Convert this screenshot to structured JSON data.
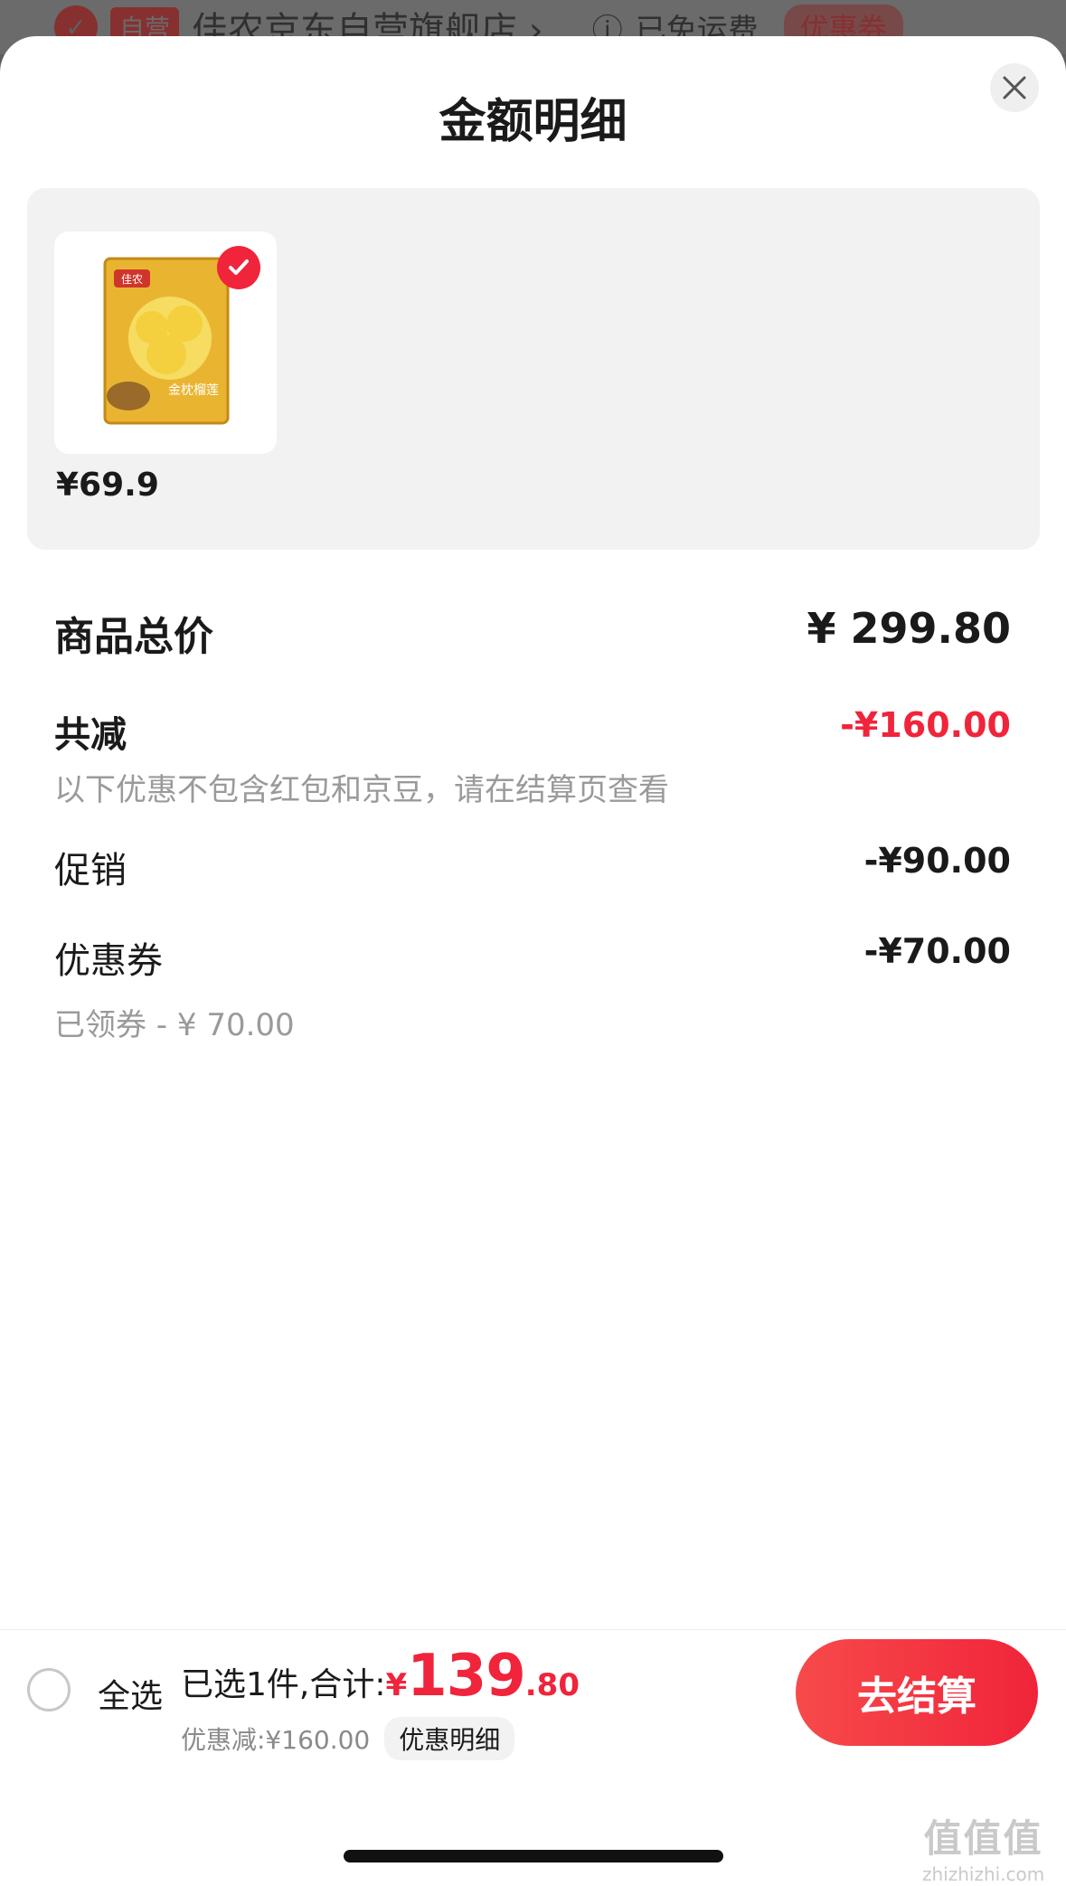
{
  "background": {
    "store_badge": "自营",
    "store_name": "佳农京东自营旗舰店 ›",
    "shipping": "已免运费",
    "coupon": "优惠券"
  },
  "sheet": {
    "title": "金额明细"
  },
  "products": [
    {
      "price": "¥69.9",
      "image_icon": "durian-package-image",
      "selected": true
    }
  ],
  "breakdown": {
    "total_label": "商品总价",
    "total_value": "¥ 299.80",
    "reduce_label": "共减",
    "reduce_value": "-¥160.00",
    "note": "以下优惠不包含红包和京豆，请在结算页查看",
    "promo_label": "促销",
    "promo_value": "-¥90.00",
    "coupon_label": "优惠券",
    "coupon_value": "-¥70.00",
    "coupon_sub": "已领券 - ¥ 70.00"
  },
  "footer": {
    "select_all": "全选",
    "selected_text": "已选1件,合计:",
    "currency": "¥",
    "amount_int": "139",
    "amount_dec": ".80",
    "discount": "优惠减:¥160.00",
    "detail_link": "优惠明细",
    "checkout": "去结算"
  },
  "watermark": {
    "big": "值值值",
    "small": "zhizhizhi.com"
  },
  "colors": {
    "accent": "#f0243a",
    "panel": "#f2f2f2"
  }
}
